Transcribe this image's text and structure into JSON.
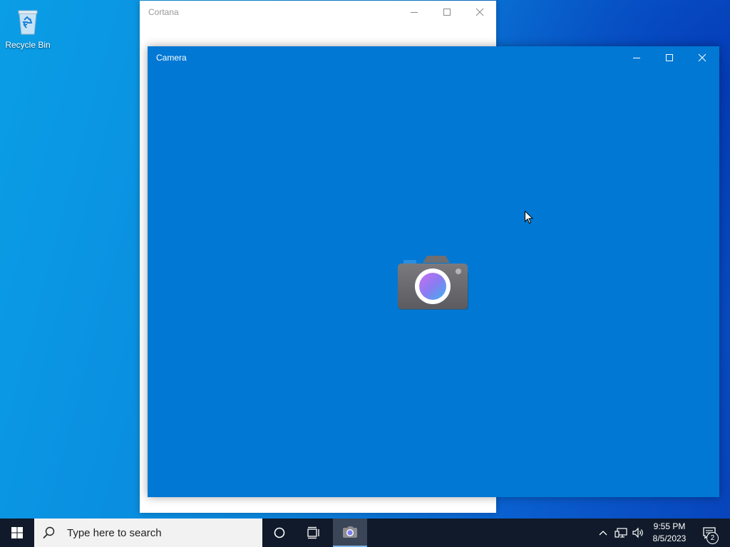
{
  "desktop": {
    "icons": [
      {
        "label": "Recycle Bin",
        "icon": "recycle-bin-icon"
      }
    ]
  },
  "windows": {
    "cortana": {
      "title": "Cortana"
    },
    "camera": {
      "title": "Camera",
      "logo_icon": "camera-icon"
    }
  },
  "taskbar": {
    "start_icon": "windows-logo-icon",
    "search_placeholder": "Type here to search",
    "cortana_icon": "circle-icon",
    "task_view_icon": "task-view-icon",
    "pinned_apps": [
      {
        "name": "Camera",
        "icon": "camera-icon",
        "active": true
      }
    ],
    "tray": {
      "chevron_icon": "chevron-up-icon",
      "network_icon": "network-icon",
      "volume_icon": "volume-icon",
      "time": "9:55 PM",
      "date": "8/5/2023",
      "notification_icon": "action-center-icon",
      "notification_count": "2"
    }
  },
  "colors": {
    "camera_bg": "#0078d4",
    "taskbar_bg": "#101a2a",
    "cortana_bg": "#ffffff"
  }
}
